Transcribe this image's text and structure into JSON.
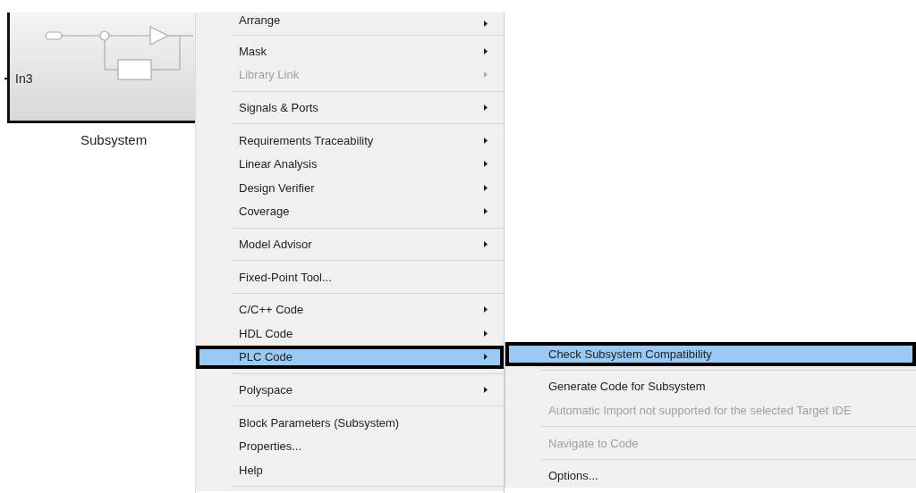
{
  "canvas": {
    "block": {
      "port_label": "In3",
      "name": "Subsystem"
    }
  },
  "context_menu": {
    "items": [
      {
        "kind": "item",
        "label": "Arrange",
        "submenu": true,
        "disabled": false,
        "selected": false
      },
      {
        "kind": "separator"
      },
      {
        "kind": "item",
        "label": "Mask",
        "submenu": true,
        "disabled": false,
        "selected": false
      },
      {
        "kind": "item",
        "label": "Library Link",
        "submenu": true,
        "disabled": true,
        "selected": false
      },
      {
        "kind": "separator"
      },
      {
        "kind": "item",
        "label": "Signals & Ports",
        "submenu": true,
        "disabled": false,
        "selected": false
      },
      {
        "kind": "separator"
      },
      {
        "kind": "item",
        "label": "Requirements Traceability",
        "submenu": true,
        "disabled": false,
        "selected": false
      },
      {
        "kind": "item",
        "label": "Linear Analysis",
        "submenu": true,
        "disabled": false,
        "selected": false
      },
      {
        "kind": "item",
        "label": "Design Verifier",
        "submenu": true,
        "disabled": false,
        "selected": false
      },
      {
        "kind": "item",
        "label": "Coverage",
        "submenu": true,
        "disabled": false,
        "selected": false
      },
      {
        "kind": "separator"
      },
      {
        "kind": "item",
        "label": "Model Advisor",
        "submenu": true,
        "disabled": false,
        "selected": false
      },
      {
        "kind": "separator"
      },
      {
        "kind": "item",
        "label": "Fixed-Point Tool...",
        "submenu": false,
        "disabled": false,
        "selected": false
      },
      {
        "kind": "separator"
      },
      {
        "kind": "item",
        "label": "C/C++ Code",
        "submenu": true,
        "disabled": false,
        "selected": false
      },
      {
        "kind": "item",
        "label": "HDL Code",
        "submenu": true,
        "disabled": false,
        "selected": false
      },
      {
        "kind": "item",
        "label": "PLC Code",
        "submenu": true,
        "disabled": false,
        "selected": true
      },
      {
        "kind": "separator"
      },
      {
        "kind": "item",
        "label": "Polyspace",
        "submenu": true,
        "disabled": false,
        "selected": false
      },
      {
        "kind": "separator"
      },
      {
        "kind": "item",
        "label": "Block Parameters (Subsystem)",
        "submenu": false,
        "disabled": false,
        "selected": false
      },
      {
        "kind": "item",
        "label": "Properties...",
        "submenu": false,
        "disabled": false,
        "selected": false
      },
      {
        "kind": "item",
        "label": "Help",
        "submenu": false,
        "disabled": false,
        "selected": false
      },
      {
        "kind": "separator"
      }
    ]
  },
  "submenu": {
    "items": [
      {
        "kind": "item",
        "label": "Check Subsystem Compatibility",
        "disabled": false,
        "selected": true
      },
      {
        "kind": "separator"
      },
      {
        "kind": "item",
        "label": "Generate Code for Subsystem",
        "disabled": false,
        "selected": false
      },
      {
        "kind": "item",
        "label": "Automatic Import not supported for the selected Target IDE",
        "disabled": true,
        "selected": false
      },
      {
        "kind": "separator"
      },
      {
        "kind": "item",
        "label": "Navigate to Code",
        "disabled": true,
        "selected": false
      },
      {
        "kind": "separator"
      },
      {
        "kind": "item",
        "label": "Options...",
        "disabled": false,
        "selected": false
      }
    ]
  }
}
